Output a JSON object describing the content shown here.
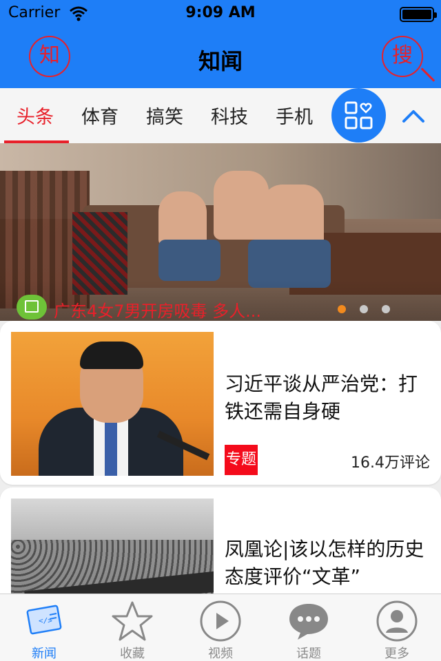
{
  "status_bar": {
    "carrier": "Carrier",
    "time": "9:09 AM"
  },
  "nav": {
    "title": "知闻",
    "left_button": "知",
    "right_button": "搜"
  },
  "tabs": [
    {
      "label": "头条",
      "active": true
    },
    {
      "label": "体育",
      "active": false
    },
    {
      "label": "搞笑",
      "active": false
    },
    {
      "label": "科技",
      "active": false
    },
    {
      "label": "手机",
      "active": false
    }
  ],
  "banner": {
    "caption": "广东4女7男开房吸毒 多人...",
    "dots": 3,
    "active_dot": 1
  },
  "articles": [
    {
      "title": "习近平谈从严治党：打铁还需自身硬",
      "tag": "专题",
      "comments": "16.4万评论"
    },
    {
      "title": "凤凰论|该以怎样的历史态度评价“文革”"
    }
  ],
  "tabbar": [
    {
      "label": "新闻",
      "icon": "news-icon",
      "active": true
    },
    {
      "label": "收藏",
      "icon": "star-icon",
      "active": false
    },
    {
      "label": "视频",
      "icon": "play-icon",
      "active": false
    },
    {
      "label": "话题",
      "icon": "chat-icon",
      "active": false
    },
    {
      "label": "更多",
      "icon": "user-icon",
      "active": false
    }
  ],
  "colors": {
    "accent_blue": "#1e7ef7",
    "accent_red": "#e8202a",
    "active_dot": "#f28a1e"
  }
}
